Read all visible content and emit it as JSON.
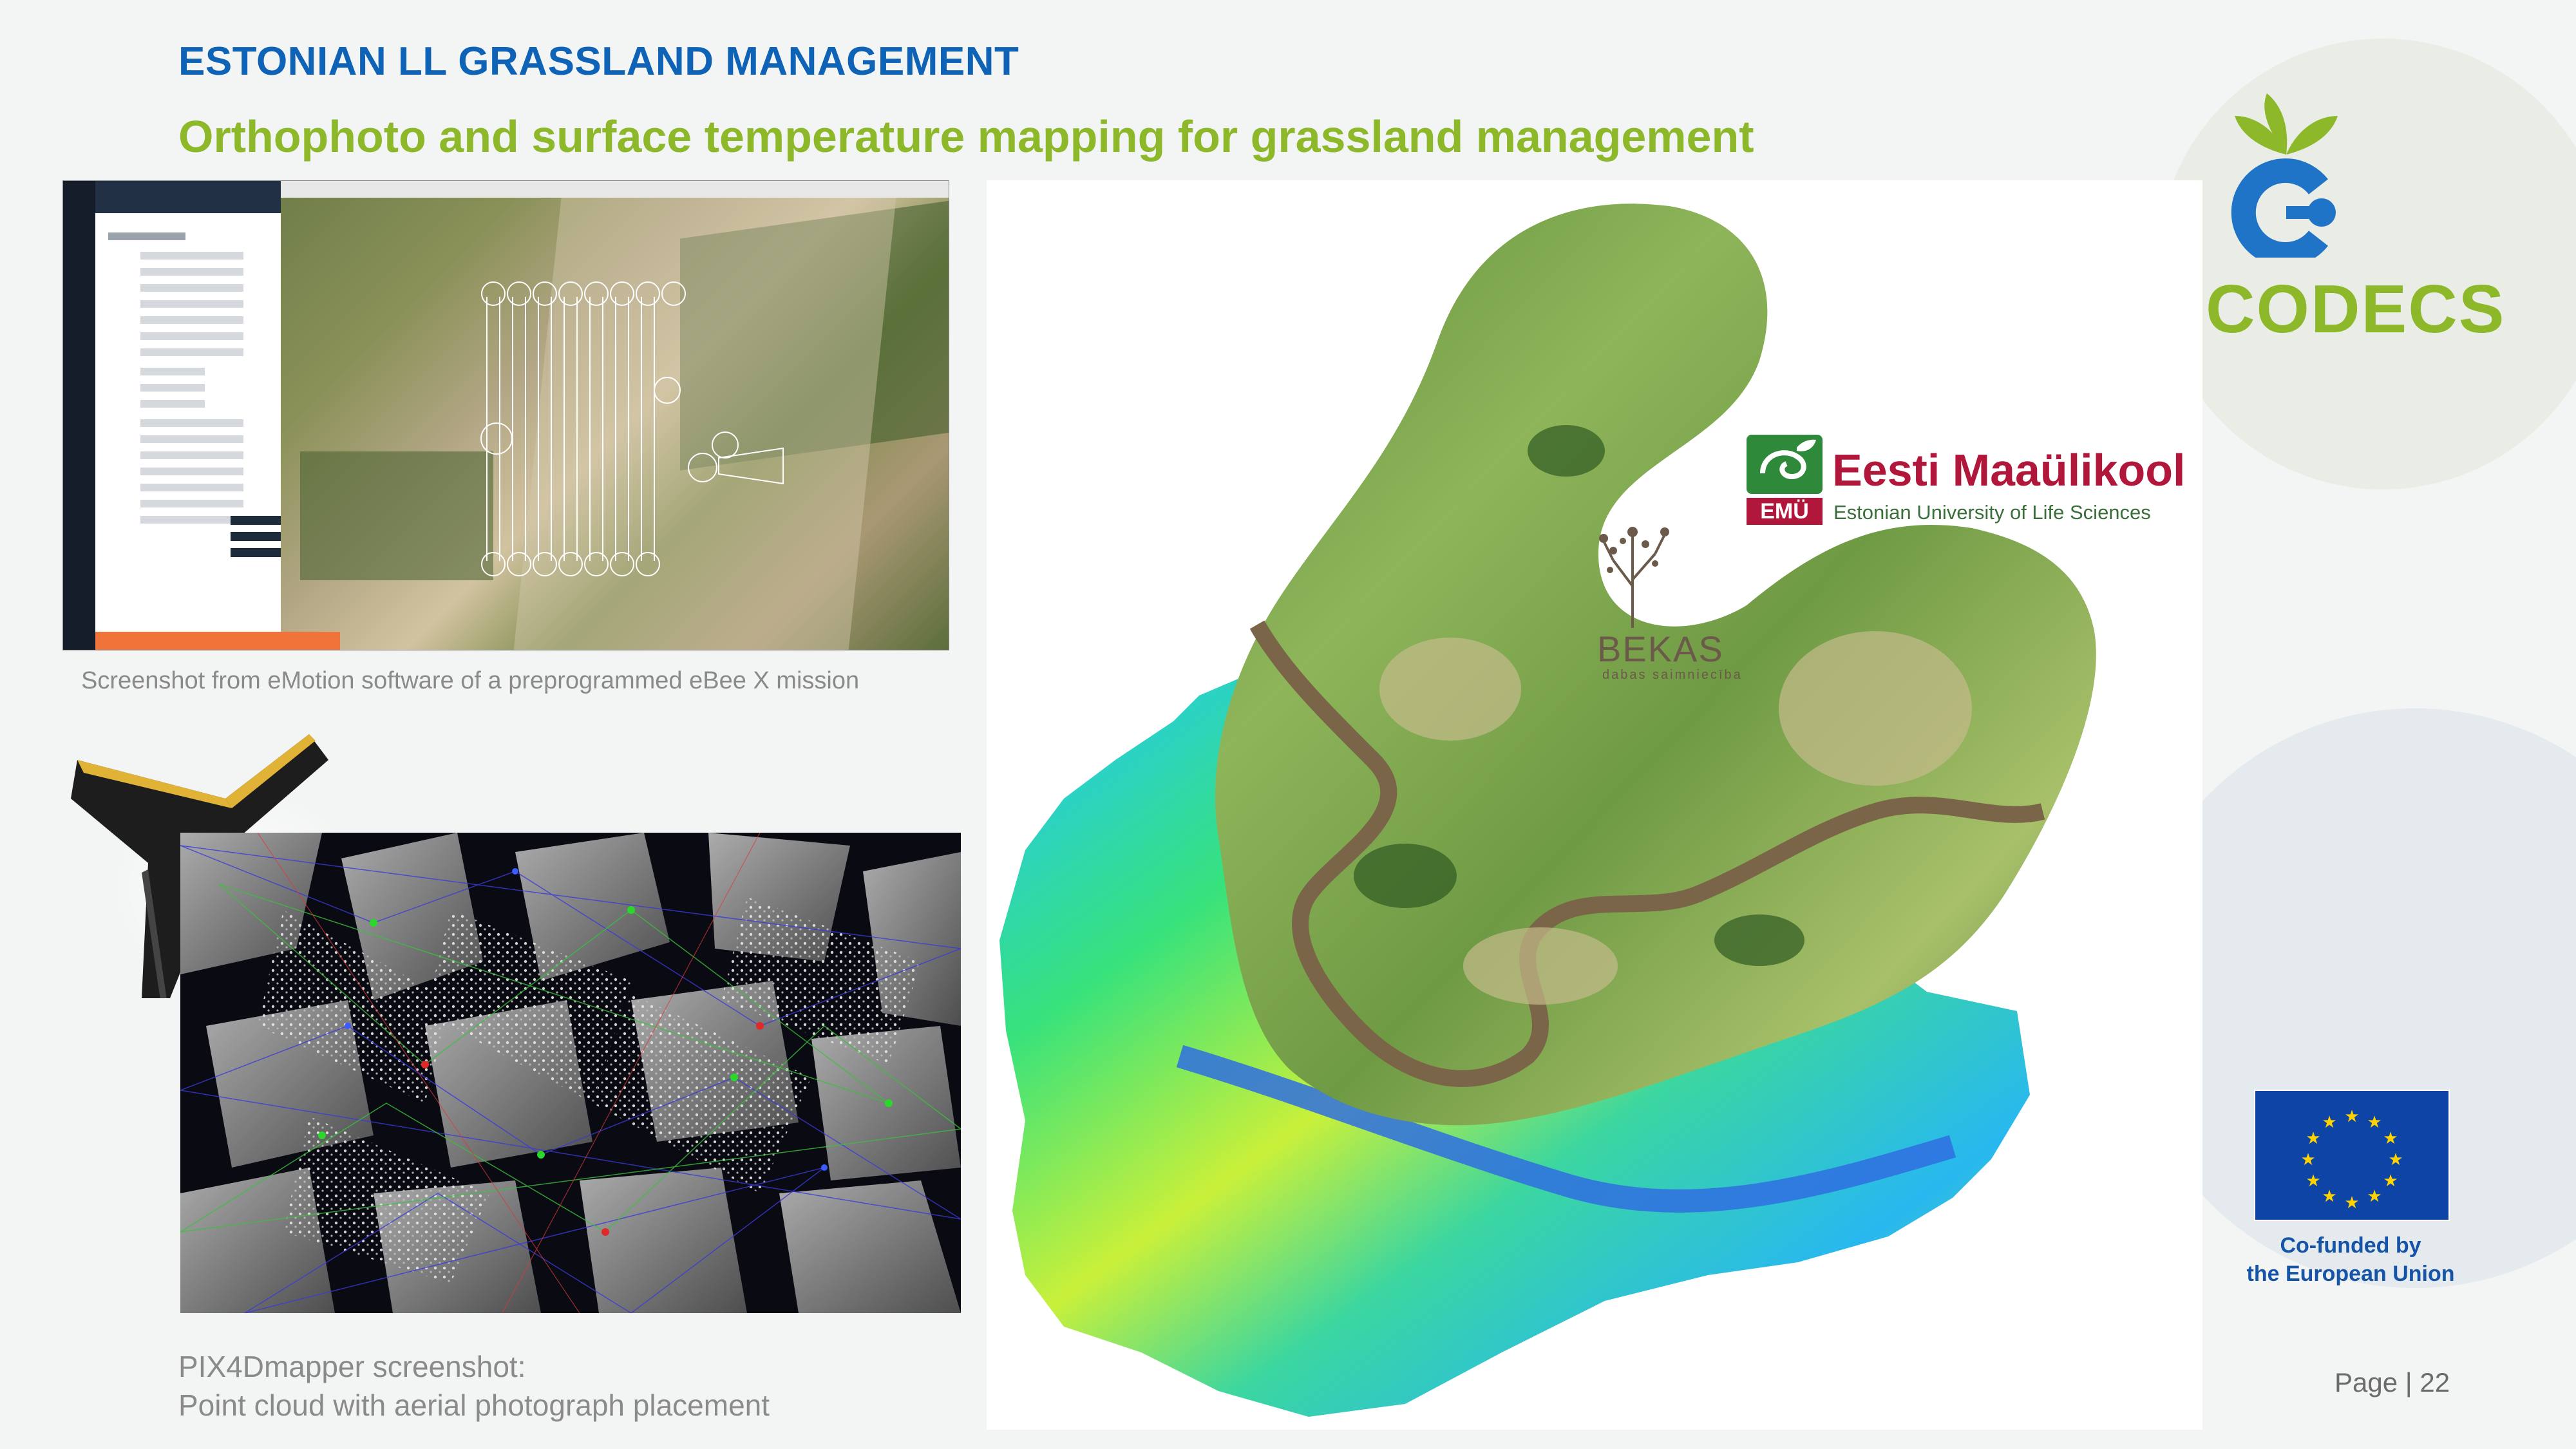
{
  "header": {
    "section_title": "ESTONIAN LL GRASSLAND MANAGEMENT",
    "slide_title": "Orthophoto and surface temperature mapping for grassland management"
  },
  "captions": {
    "emotion": "Screenshot from eMotion software of a preprogrammed eBee X mission",
    "pix4d_line1": "PIX4Dmapper screenshot:",
    "pix4d_line2": "Point cloud with aerial photograph placement"
  },
  "logos": {
    "codecs": "CODECS",
    "emu_name": "Eesti Maaülikool",
    "emu_subtitle": "Estonian University of Life Sciences",
    "emu_mark": "EMÜ",
    "bekas_name": "BEKAS",
    "bekas_subtitle": "dabas saimniecība",
    "eu_line1": "Co-funded by",
    "eu_line2": "the European Union"
  },
  "footer": {
    "page": "Page | 22"
  },
  "colors": {
    "title_blue": "#0f63b7",
    "title_green": "#8cb82a",
    "emu_red": "#b0173a",
    "eu_blue": "#0f44a7",
    "eu_star": "#ffd200"
  }
}
